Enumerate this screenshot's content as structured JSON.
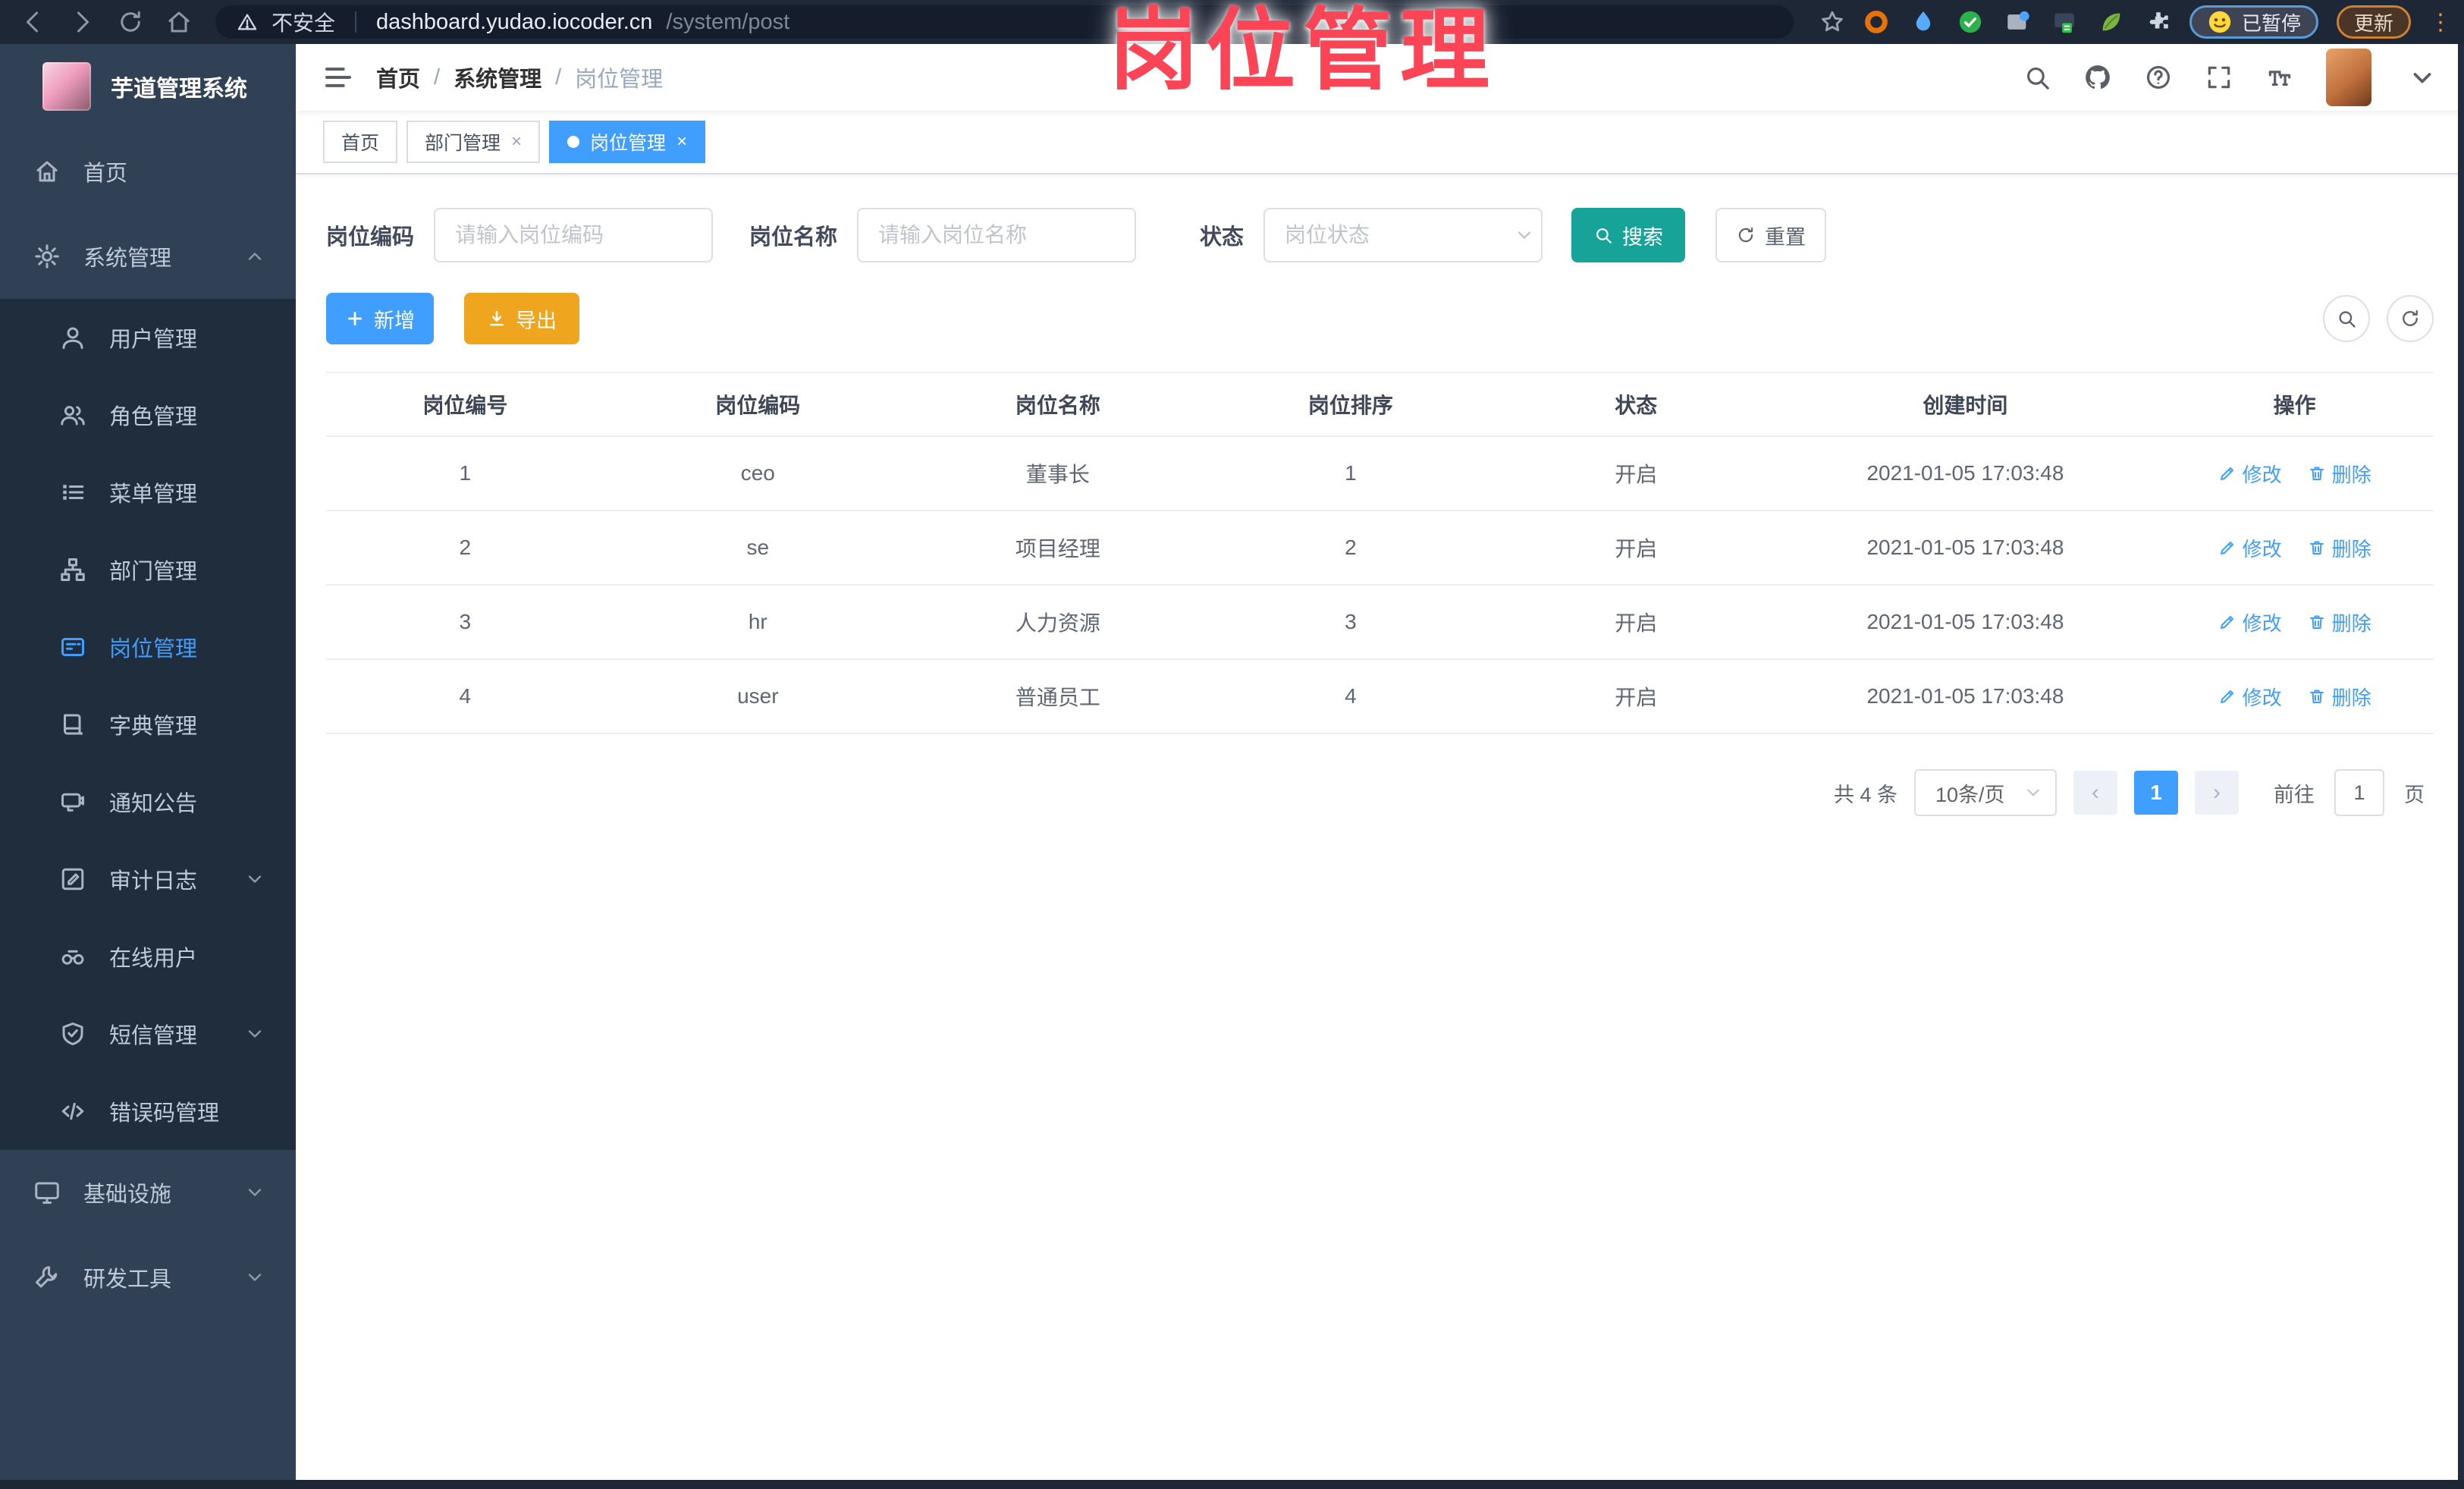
{
  "colors": {
    "primary": "#409EFF",
    "search_teal": "#17a398",
    "export_orange": "#f0a51f",
    "overlay_pink": "#fb4557",
    "sidebar_bg": "#304156",
    "submenu_bg": "#1f2d3d"
  },
  "overlay_title": "岗位管理",
  "browser": {
    "nav": [
      {
        "icon": "back-arrow-icon"
      },
      {
        "icon": "forward-arrow-icon"
      },
      {
        "icon": "reload-icon"
      },
      {
        "icon": "home-icon"
      }
    ],
    "security_label": "不安全",
    "url_host": "dashboard.yudao.iocoder.cn",
    "url_path": "/system/post",
    "extensions": [
      {
        "icon": "extension-orange-ring-icon"
      },
      {
        "icon": "extension-blue-drop-icon"
      },
      {
        "icon": "extension-green-check-icon"
      },
      {
        "icon": "extension-grid-icon"
      },
      {
        "icon": "extension-screen-icon"
      },
      {
        "icon": "extension-leaf-icon"
      },
      {
        "icon": "extension-puzzle-icon"
      }
    ],
    "paused_label": "已暂停",
    "update_label": "更新",
    "menu_dots": "⋮"
  },
  "sidebar": {
    "title": "芋道管理系统",
    "items": [
      {
        "icon": "home-menu-icon",
        "label": "首页",
        "level": "root"
      },
      {
        "icon": "gear-icon",
        "label": "系统管理",
        "level": "root",
        "chevron": "up"
      },
      {
        "icon": "user-icon",
        "label": "用户管理",
        "level": "sub"
      },
      {
        "icon": "users-icon",
        "label": "角色管理",
        "level": "sub"
      },
      {
        "icon": "list-icon",
        "label": "菜单管理",
        "level": "sub"
      },
      {
        "icon": "tree-icon",
        "label": "部门管理",
        "level": "sub"
      },
      {
        "icon": "badge-icon",
        "label": "岗位管理",
        "level": "sub",
        "active": true
      },
      {
        "icon": "book-icon",
        "label": "字典管理",
        "level": "sub"
      },
      {
        "icon": "megaphone-icon",
        "label": "通知公告",
        "level": "sub"
      },
      {
        "icon": "edit-icon",
        "label": "审计日志",
        "level": "sub",
        "chevron": "down"
      },
      {
        "icon": "binoculars-icon",
        "label": "在线用户",
        "level": "sub"
      },
      {
        "icon": "shield-icon",
        "label": "短信管理",
        "level": "sub",
        "chevron": "down"
      },
      {
        "icon": "code-icon",
        "label": "错误码管理",
        "level": "sub"
      },
      {
        "icon": "monitor-icon",
        "label": "基础设施",
        "level": "root",
        "chevron": "down"
      },
      {
        "icon": "tools-icon",
        "label": "研发工具",
        "level": "root",
        "chevron": "down"
      }
    ]
  },
  "header": {
    "breadcrumb": [
      {
        "label": "首页"
      },
      {
        "label": "系统管理"
      },
      {
        "label": "岗位管理",
        "current": true
      }
    ],
    "tools": [
      {
        "icon": "search-icon"
      },
      {
        "icon": "github-icon"
      },
      {
        "icon": "question-icon"
      },
      {
        "icon": "fullscreen-icon"
      },
      {
        "icon": "font-size-icon"
      }
    ]
  },
  "tabs": [
    {
      "label": "首页"
    },
    {
      "label": "部门管理",
      "closable": true
    },
    {
      "label": "岗位管理",
      "closable": true,
      "active": true,
      "dot": true
    }
  ],
  "filters": {
    "code_label": "岗位编码",
    "code_placeholder": "请输入岗位编码",
    "name_label": "岗位名称",
    "name_placeholder": "请输入岗位名称",
    "status_label": "状态",
    "status_placeholder": "岗位状态",
    "search_label": "搜索",
    "reset_label": "重置"
  },
  "toolbar": {
    "add_label": "新增",
    "export_label": "导出"
  },
  "table": {
    "columns": [
      "岗位编号",
      "岗位编码",
      "岗位名称",
      "岗位排序",
      "状态",
      "创建时间",
      "操作"
    ],
    "edit_label": "修改",
    "delete_label": "删除",
    "rows": [
      {
        "no": "1",
        "code": "ceo",
        "name": "董事长",
        "sort": "1",
        "status": "开启",
        "time": "2021-01-05 17:03:48"
      },
      {
        "no": "2",
        "code": "se",
        "name": "项目经理",
        "sort": "2",
        "status": "开启",
        "time": "2021-01-05 17:03:48"
      },
      {
        "no": "3",
        "code": "hr",
        "name": "人力资源",
        "sort": "3",
        "status": "开启",
        "time": "2021-01-05 17:03:48"
      },
      {
        "no": "4",
        "code": "user",
        "name": "普通员工",
        "sort": "4",
        "status": "开启",
        "time": "2021-01-05 17:03:48"
      }
    ]
  },
  "pagination": {
    "total_label": "共 4 条",
    "page_size": "10条/页",
    "prev": "‹",
    "page": "1",
    "next": "›",
    "goto_label": "前往",
    "goto_value": "1",
    "unit_label": "页"
  }
}
